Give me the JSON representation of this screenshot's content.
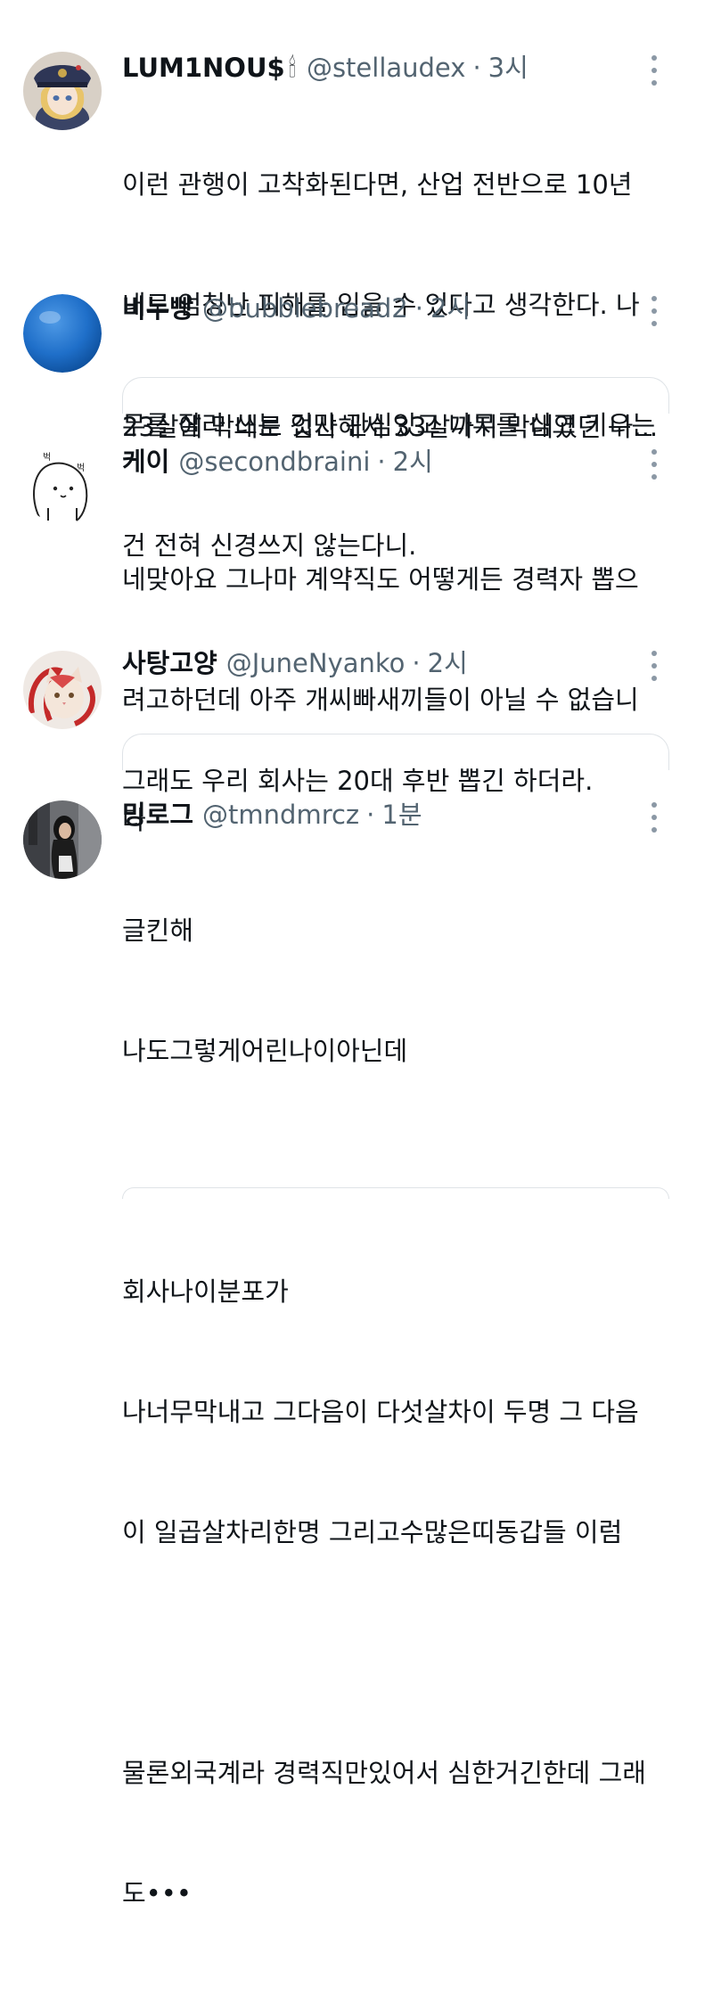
{
  "tweets": [
    {
      "name": "LUM1NOU$",
      "emoji": "🕯",
      "handle": "@stellaudex",
      "time": "3시",
      "avatar_icon": "anime-police-girl-avatar",
      "lines": [
        "이런 관행이 고착화된다면, 산업 전반으로 10년",
        "내로 엄청난 피해를 입을 수 있다고 생각한다. 나",
        "무를 잘라 쓰는 것만 관심있고 나무를 심고 키우는",
        "건 전혀 신경쓰지 않는다니."
      ]
    },
    {
      "name": "비누빵",
      "handle": "@bubblebread2",
      "time": "2시",
      "avatar_icon": "blue-ball-avatar",
      "lines": [
        "23살에 막내로 입사해서 33살까지 막내였던 나..."
      ]
    },
    {
      "name": "케이",
      "handle": "@secondbraini",
      "time": "2시",
      "avatar_icon": "doodle-creature-avatar",
      "avatar_text": [
        "벅",
        "벅"
      ],
      "lines": [
        "네맞아요 그나마 계약직도 어떻게든 경력자 뽑으",
        "려고하던데 아주 개씨빠새끼들이 아닐 수 없습니",
        "다"
      ]
    },
    {
      "name": "사탕고양",
      "handle": "@JuneNyanko",
      "time": "2시",
      "avatar_icon": "cat-avatar",
      "lines": [
        "그래도 우리 회사는 20대 후반 뽑긴 하더라."
      ]
    },
    {
      "name": "밍로그",
      "handle": "@tmndmrcz",
      "time": "1분",
      "avatar_icon": "woman-photo-avatar",
      "lines": [
        "글킨해",
        "나도그렇게어린나이아닌데",
        "",
        "회사나이분포가",
        "나너무막내고 그다음이 다섯살차이 두명 그 다음",
        "이 일곱살차리한명 그리고수많은띠동갑들 이럼",
        "",
        "물론외국계라 경력직만있어서 심한거긴한데 그래",
        "도•••"
      ]
    }
  ],
  "colors": {
    "text": "#0f1419",
    "secondary": "#536471",
    "border": "#dfe3e7"
  }
}
